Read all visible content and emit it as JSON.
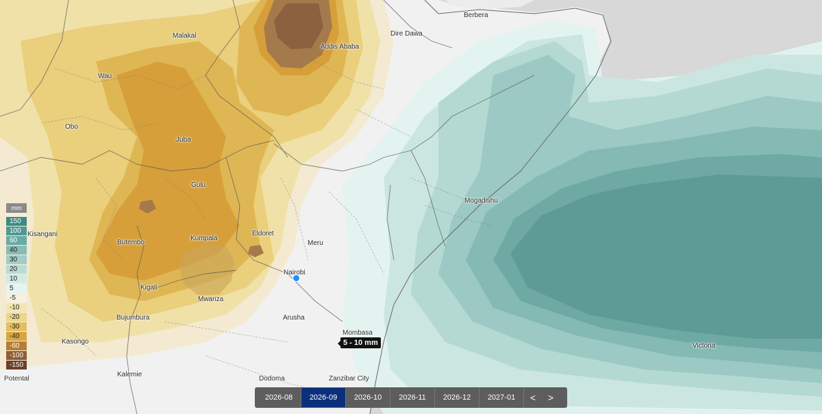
{
  "map": {
    "tooltip": "5 - 10 mm",
    "places": [
      {
        "id": "berbera",
        "name": "Berbera"
      },
      {
        "id": "dire-dawa",
        "name": "Dire Dawa"
      },
      {
        "id": "addis-ababa",
        "name": "Addis Ababa"
      },
      {
        "id": "malakal",
        "name": "Malakal"
      },
      {
        "id": "wau",
        "name": "Wau"
      },
      {
        "id": "obo",
        "name": "Obo"
      },
      {
        "id": "juba",
        "name": "Juba"
      },
      {
        "id": "gulu",
        "name": "Gulu"
      },
      {
        "id": "kisangani",
        "name": "Kisangani"
      },
      {
        "id": "butembo",
        "name": "Butembo"
      },
      {
        "id": "kumpala",
        "name": "Kumpala"
      },
      {
        "id": "eldoret",
        "name": "Eldoret"
      },
      {
        "id": "meru",
        "name": "Meru"
      },
      {
        "id": "nairobi",
        "name": "Nairobi"
      },
      {
        "id": "kigali",
        "name": "Kigali"
      },
      {
        "id": "mwanza",
        "name": "Mwanza"
      },
      {
        "id": "bujumbura",
        "name": "Bujumbura"
      },
      {
        "id": "arusha",
        "name": "Arusha"
      },
      {
        "id": "mombasa",
        "name": "Mombasa"
      },
      {
        "id": "kasongo",
        "name": "Kasongo"
      },
      {
        "id": "kalemie",
        "name": "Kalemie"
      },
      {
        "id": "dodoma",
        "name": "Dodoma"
      },
      {
        "id": "zanzibar-city",
        "name": "Zanzibar City"
      },
      {
        "id": "mogadishu",
        "name": "Mogadishu"
      },
      {
        "id": "victoria",
        "name": "Victoria"
      },
      {
        "id": "kindu",
        "name": "Potental"
      }
    ]
  },
  "legend": {
    "unit": "mm",
    "entries": [
      {
        "label": "150",
        "color": "#3d8a84"
      },
      {
        "label": "100",
        "color": "#4f9993"
      },
      {
        "label": "60",
        "color": "#6aaaa4"
      },
      {
        "label": "40",
        "color": "#86bbb6"
      },
      {
        "label": "30",
        "color": "#a1ccc7"
      },
      {
        "label": "20",
        "color": "#b9dcd7"
      },
      {
        "label": "10",
        "color": "#d2ebe6"
      },
      {
        "label": "5",
        "color": "#e6f4f1"
      },
      {
        "label": "-5",
        "color": "#f5f1de"
      },
      {
        "label": "-10",
        "color": "#f2e6b4"
      },
      {
        "label": "-20",
        "color": "#ecd58c"
      },
      {
        "label": "-30",
        "color": "#e2bf62"
      },
      {
        "label": "-40",
        "color": "#d7a63f"
      },
      {
        "label": "-60",
        "color": "#b57d35"
      },
      {
        "label": "-100",
        "color": "#8f5e34"
      },
      {
        "label": "-150",
        "color": "#6a4027"
      }
    ]
  },
  "timeline": {
    "months": [
      "2026-08",
      "2026-09",
      "2026-10",
      "2026-11",
      "2026-12",
      "2027-01"
    ],
    "active": "2026-09",
    "prev_label": "<",
    "next_label": ">"
  }
}
